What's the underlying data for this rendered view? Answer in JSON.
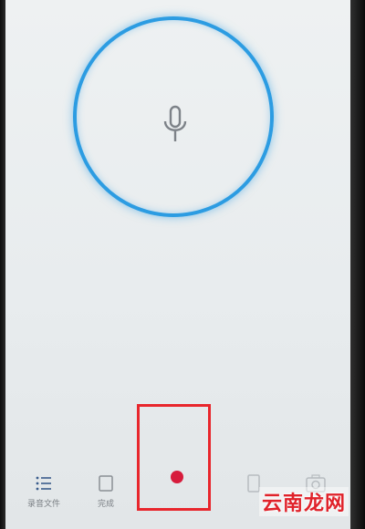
{
  "bottom_bar": {
    "items": [
      {
        "label": "录音文件",
        "icon": "list-icon"
      },
      {
        "label": "完成",
        "icon": "square-icon"
      }
    ],
    "record_button": {
      "icon": "record-dot-icon"
    }
  },
  "watermark": {
    "text": "云南龙网"
  },
  "colors": {
    "ring": "#2c9ce2",
    "record_dot": "#d71c3c",
    "highlight_box": "#e8262c",
    "watermark": "#e0222a"
  }
}
